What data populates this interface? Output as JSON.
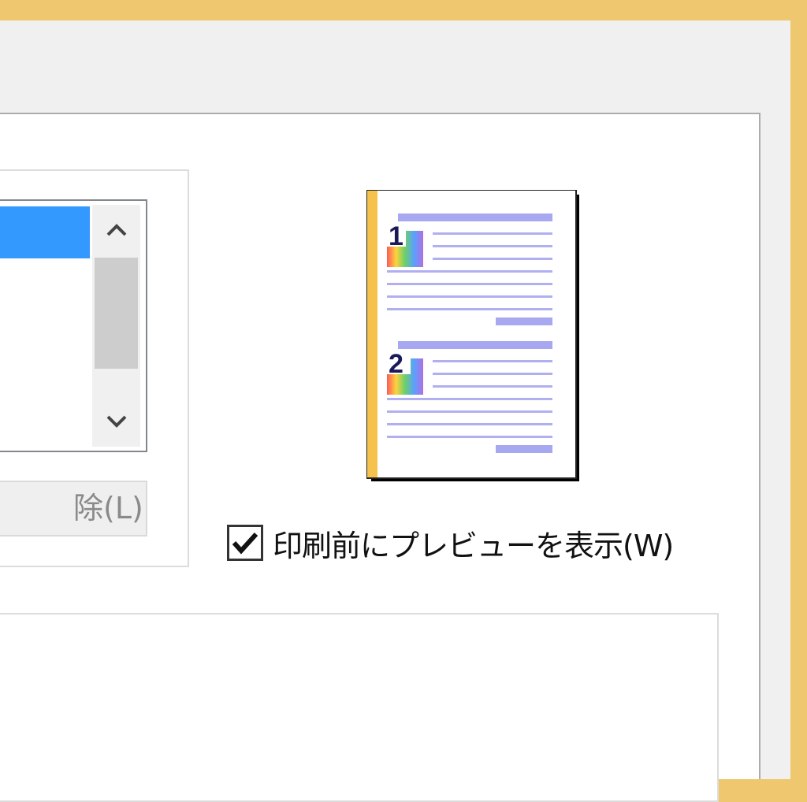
{
  "window": {
    "frame_color": "#eec76f"
  },
  "listbox": {
    "selected_color": "#3399ff"
  },
  "scrollbar": {
    "up_icon": "chevron-up-icon",
    "down_icon": "chevron-down-icon"
  },
  "buttons": {
    "delete_label": "除(L)"
  },
  "preview": {
    "page1_number": "1",
    "page2_number": "2"
  },
  "options": {
    "show_preview_label": "印刷前にプレビューを表示(W)",
    "show_preview_checked": true
  }
}
